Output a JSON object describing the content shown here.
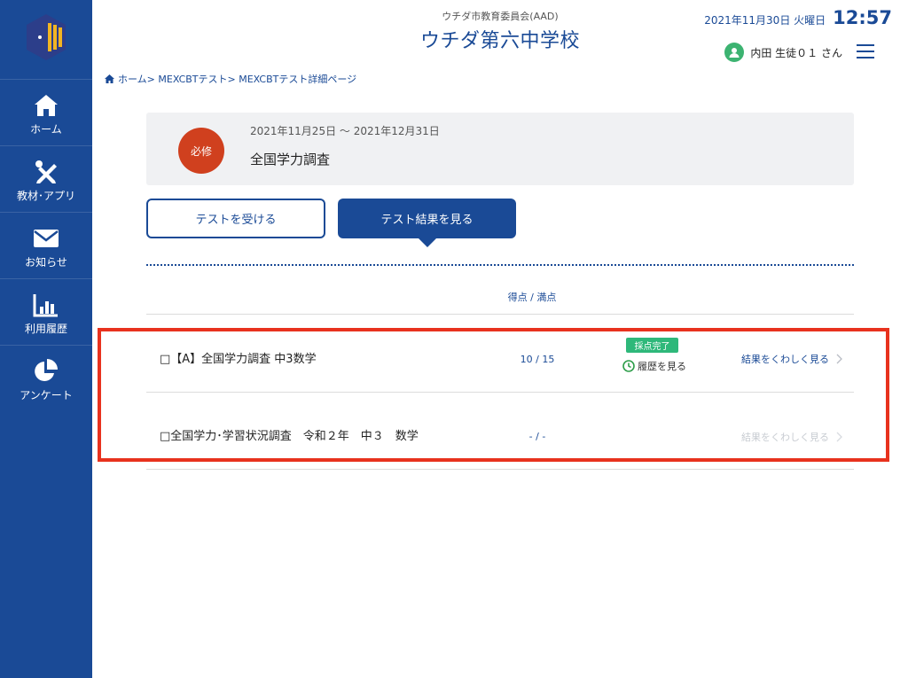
{
  "sidebar": {
    "items": [
      {
        "icon": "home-icon",
        "label": "ホーム"
      },
      {
        "icon": "tools-icon",
        "label": "教材･アプリ"
      },
      {
        "icon": "mail-icon",
        "label": "お知らせ"
      },
      {
        "icon": "bar-chart-icon",
        "label": "利用履歴"
      },
      {
        "icon": "pie-chart-icon",
        "label": "アンケート"
      }
    ]
  },
  "header": {
    "board_name": "ウチダ市教育委員会(AAD)",
    "school_name": "ウチダ第六中学校",
    "date": "2021年11月30日 火曜日",
    "time": "12:57",
    "user_name": "内田 生徒０１ さん"
  },
  "breadcrumb": [
    "ホーム",
    "MEXCBTテスト",
    "MEXCBTテスト詳細ページ"
  ],
  "breadcrumb_separator": ">",
  "test_info": {
    "badge": "必修",
    "period": "2021年11月25日 〜 2021年12月31日",
    "title": "全国学力調査"
  },
  "buttons": {
    "take_test": "テストを受ける",
    "view_results": "テスト結果を見る"
  },
  "table": {
    "score_header": "得点 / 満点",
    "rows": [
      {
        "title": "□【A】全国学力調査 中3数学",
        "score": "10 / 15",
        "status_badge": "採点完了",
        "history_link": "履歴を見る",
        "detail_link": "結果をくわしく見る",
        "detail_enabled": true
      },
      {
        "title": "□全国学力･学習状況調査　令和２年　中３　数学",
        "score": "- / -",
        "detail_link": "結果をくわしく見る",
        "detail_enabled": false
      }
    ]
  },
  "colors": {
    "primary": "#1a4a96",
    "required_badge": "#d0401e",
    "graded_badge": "#2eb87a",
    "highlight": "#e8321e"
  }
}
